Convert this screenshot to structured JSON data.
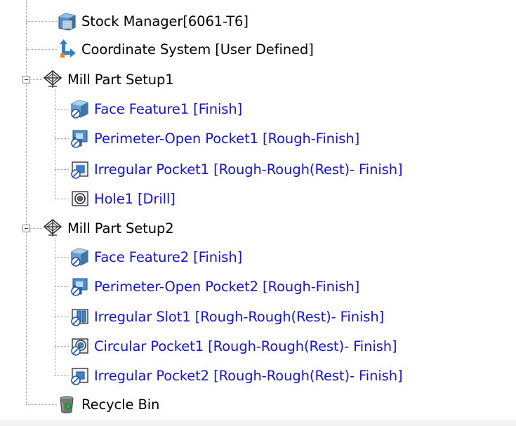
{
  "tree": {
    "root_items": {
      "stock_manager": {
        "label": "Stock Manager[6061-T6]",
        "icon": "stock-manager-icon"
      },
      "coordinate_system": {
        "label": "Coordinate System [User Defined]",
        "icon": "coordinate-system-icon"
      },
      "recycle_bin": {
        "label": "Recycle Bin",
        "icon": "recycle-bin-icon"
      }
    },
    "setups": [
      {
        "label": "Mill Part Setup1",
        "icon": "mill-part-setup-icon",
        "expanded": true,
        "features": [
          {
            "label": "Face Feature1 [Finish]",
            "icon": "face-feature-icon"
          },
          {
            "label": "Perimeter-Open Pocket1 [Rough-Finish]",
            "icon": "open-pocket-icon"
          },
          {
            "label": "Irregular Pocket1 [Rough-Rough(Rest)- Finish]",
            "icon": "irregular-pocket-icon"
          },
          {
            "label": "Hole1 [Drill]",
            "icon": "hole-icon"
          }
        ]
      },
      {
        "label": "Mill Part Setup2",
        "icon": "mill-part-setup-icon",
        "expanded": true,
        "features": [
          {
            "label": "Face Feature2 [Finish]",
            "icon": "face-feature-icon"
          },
          {
            "label": "Perimeter-Open Pocket2 [Rough-Finish]",
            "icon": "open-pocket-icon"
          },
          {
            "label": "Irregular Slot1 [Rough-Rough(Rest)- Finish]",
            "icon": "irregular-slot-icon"
          },
          {
            "label": "Circular Pocket1 [Rough-Rough(Rest)- Finish]",
            "icon": "circular-pocket-icon"
          },
          {
            "label": "Irregular Pocket2 [Rough-Rough(Rest)- Finish]",
            "icon": "irregular-pocket-icon"
          }
        ]
      }
    ],
    "colors": {
      "root_label": "#000000",
      "feature_label": "#1414d6",
      "connector": "#a0a0a0"
    }
  }
}
